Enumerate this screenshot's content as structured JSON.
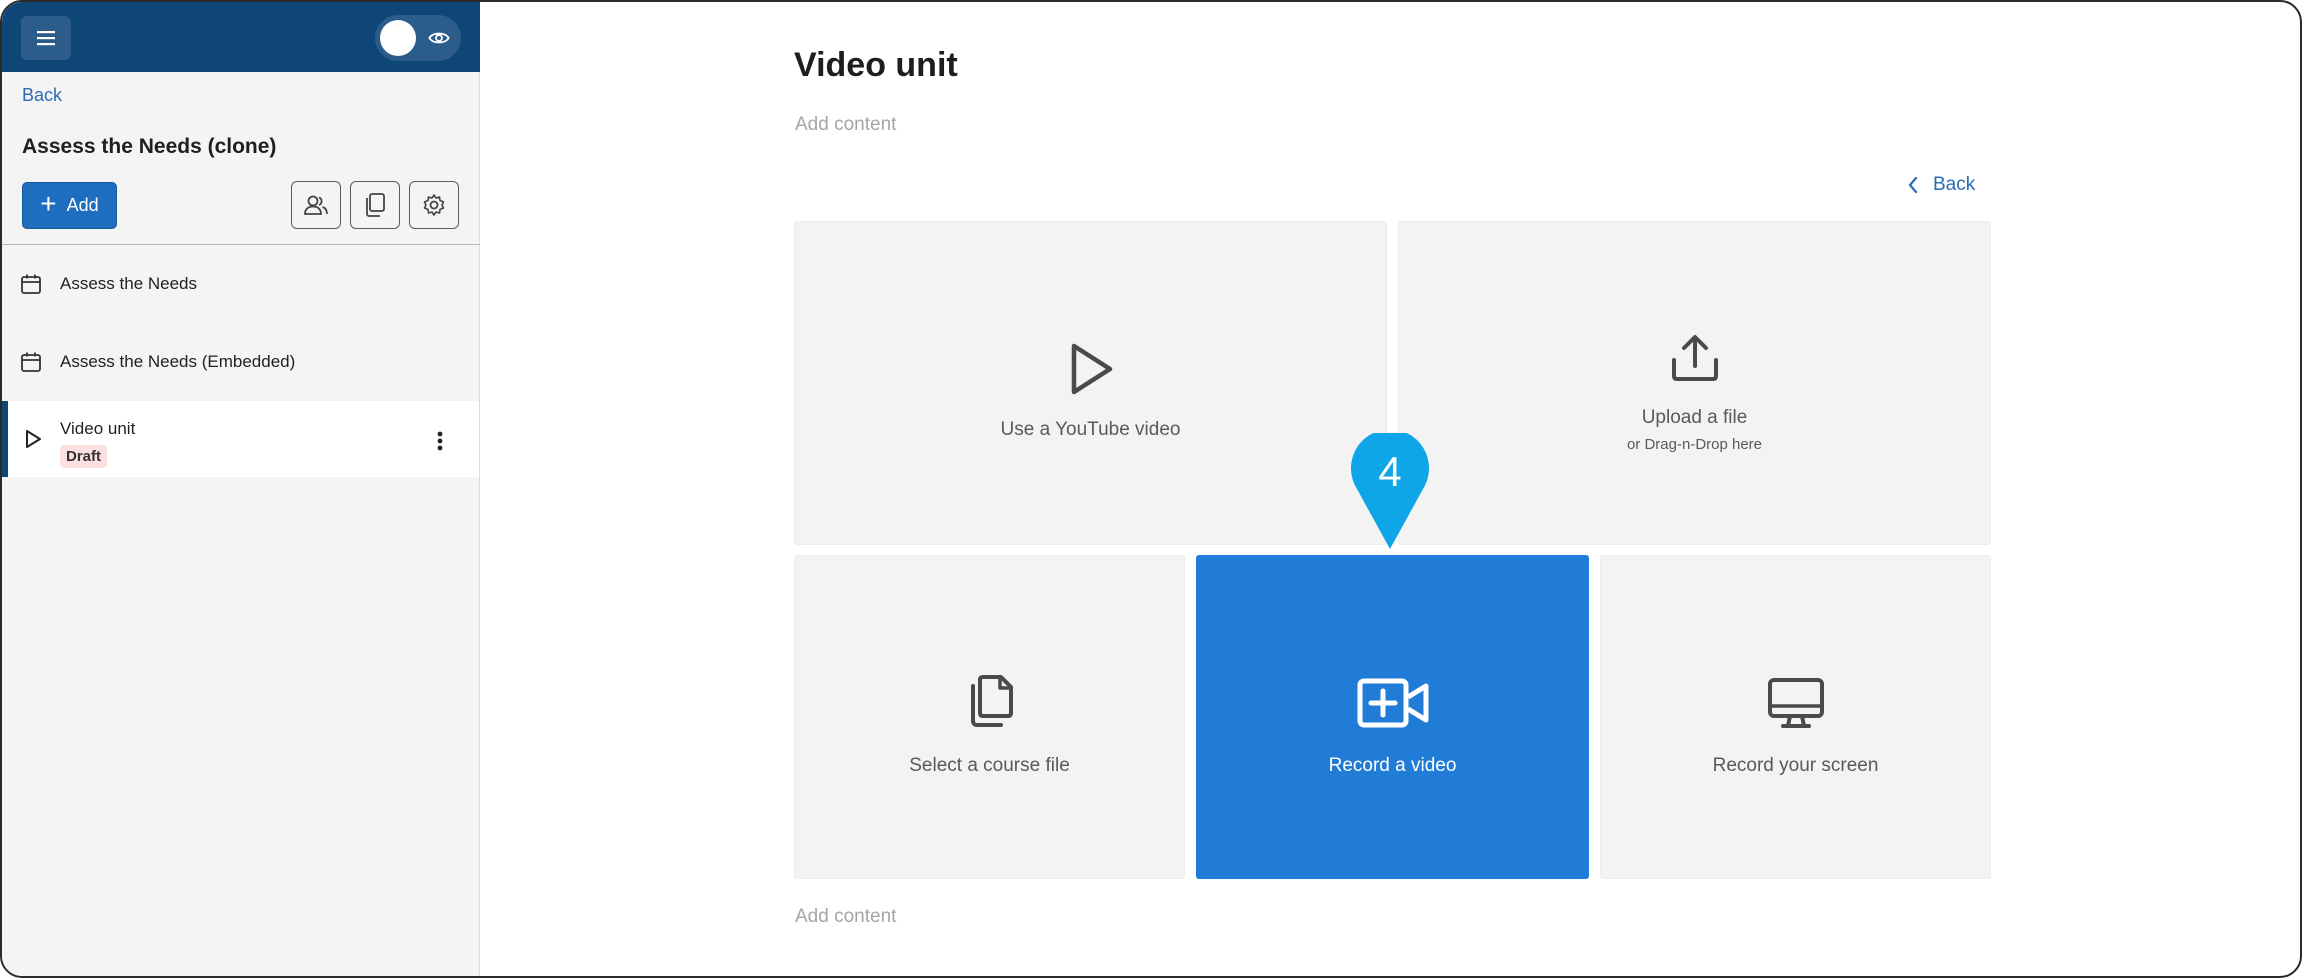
{
  "sidebar": {
    "back_label": "Back",
    "course_title": "Assess the Needs (clone)",
    "add_label": "Add",
    "items": [
      {
        "label": "Assess the Needs"
      },
      {
        "label": "Assess the Needs (Embedded)"
      },
      {
        "label": "Video unit",
        "badge": "Draft"
      }
    ]
  },
  "main": {
    "title": "Video unit",
    "add_content_top": "Add content",
    "add_content_bottom": "Add content",
    "back_label": "Back",
    "tiles": {
      "youtube": {
        "label": "Use a YouTube video"
      },
      "upload": {
        "label": "Upload a file",
        "sublabel": "or Drag-n-Drop here"
      },
      "course_file": {
        "label": "Select a course file"
      },
      "record_video": {
        "label": "Record a video"
      },
      "record_screen": {
        "label": "Record your screen"
      }
    },
    "step_marker": "4"
  },
  "colors": {
    "sidebar_header": "#0e4677",
    "accent": "#217cd8",
    "pin": "#0ea5e9",
    "link": "#2a6cb2",
    "badge_bg": "#fbe0df"
  }
}
